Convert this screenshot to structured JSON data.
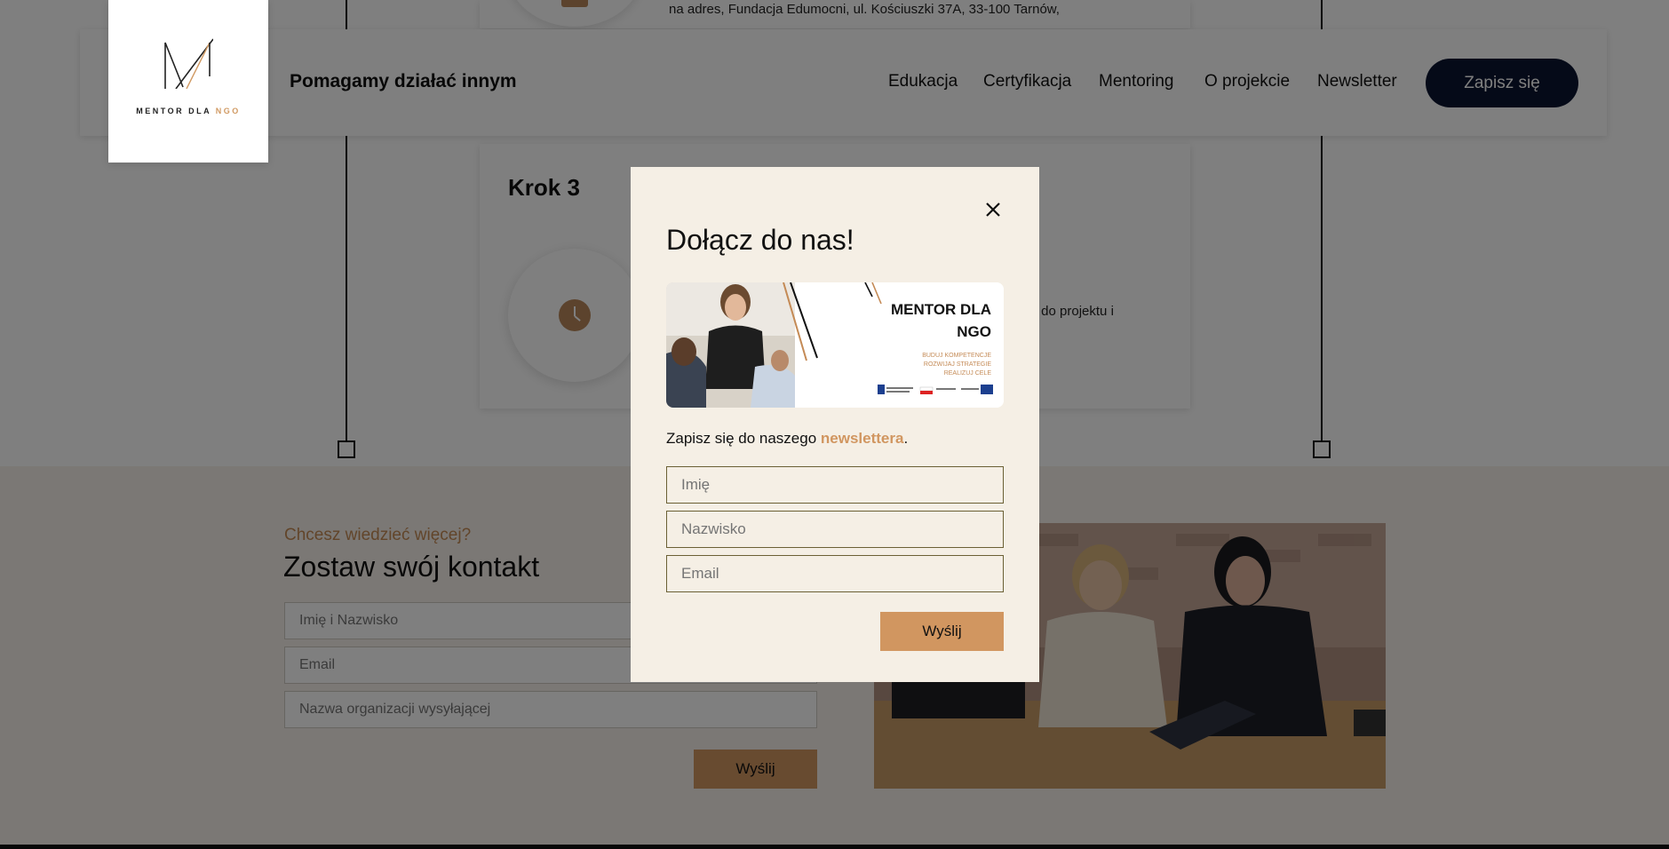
{
  "header": {
    "logo": {
      "name": "MENTOR DLA",
      "accent": "NGO"
    },
    "tagline": "Pomagamy działać innym",
    "nav": [
      "Edukacja",
      "Certyfikacja",
      "Mentoring",
      "O projekcie",
      "Newsletter"
    ],
    "cta_label": "Zapisz się"
  },
  "steps": {
    "prev_address": "na adres, Fundacja Edumocni, ul. Kościuszki 37A, 33-100 Tarnów,",
    "step3_title": "Krok 3",
    "step3_text_fragment": "niu do projektu i"
  },
  "contact": {
    "subtitle": "Chcesz wiedzieć więcej?",
    "title": "Zostaw swój kontakt",
    "name_placeholder": "Imię i Nazwisko",
    "email_placeholder": "Email",
    "org_placeholder": "Nazwa organizacji wysyłającej",
    "submit_label": "Wyślij"
  },
  "modal": {
    "title": "Dołącz do nas!",
    "banner": {
      "title": "MENTOR DLA NGO",
      "lines": [
        "BUDUJ KOMPETENCJE",
        "ROZWIJAJ STRATEGIE",
        "REALIZUJ CELE"
      ]
    },
    "text_before": "Zapisz się do naszego ",
    "text_highlight": "newslettera",
    "text_after": ".",
    "first_name_placeholder": "Imię",
    "last_name_placeholder": "Nazwisko",
    "email_placeholder": "Email",
    "submit_label": "Wyślij"
  },
  "colors": {
    "accent": "#d19660",
    "navy": "#0b1430",
    "modal_bg": "#f5efe5",
    "contact_bg": "#f6f1ea"
  },
  "icons": [
    "close-icon",
    "clock-icon",
    "logo-mark-icon"
  ]
}
